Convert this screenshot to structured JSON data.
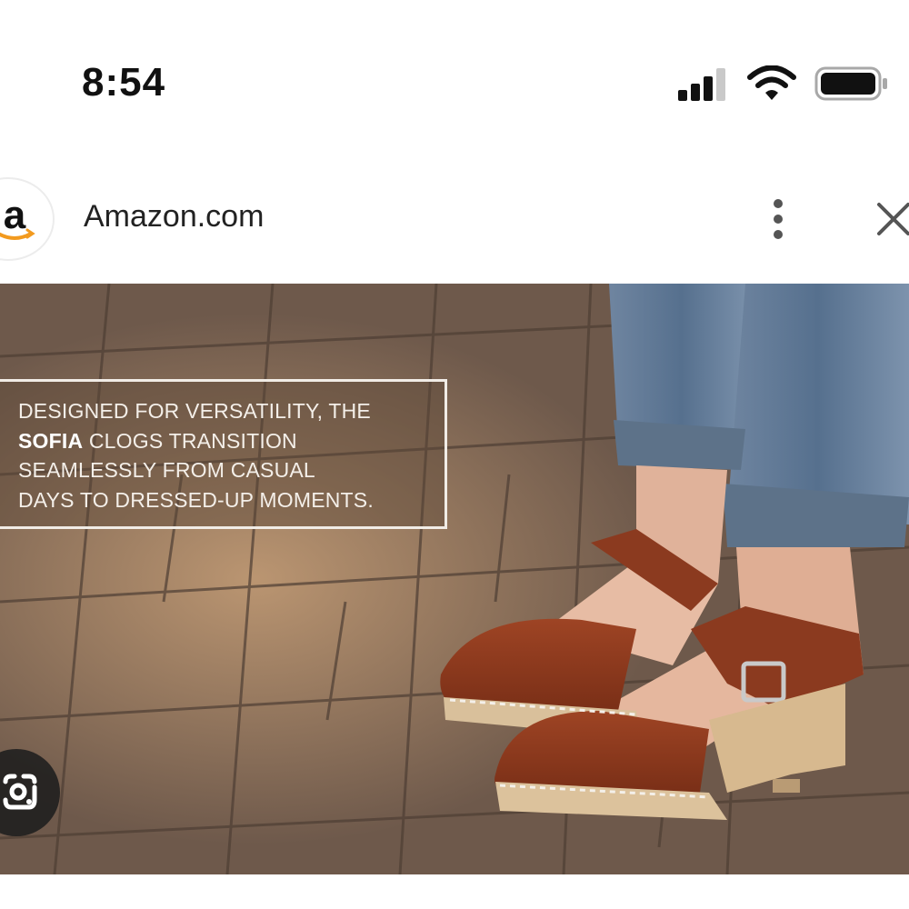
{
  "status_bar": {
    "time": "8:54",
    "signal_icon": "cellular-signal-icon",
    "wifi_icon": "wifi-icon",
    "battery_icon": "battery-icon"
  },
  "browser": {
    "favicon_icon": "amazon-logo-icon",
    "favicon_letter": "a",
    "site_name": "Amazon.com",
    "more_icon": "more-vertical-icon",
    "close_icon": "close-icon"
  },
  "hero": {
    "promo_lines": [
      "DESIGNED FOR VERSATILITY, THE",
      "SOFIA",
      " CLOGS TRANSITION",
      "SEAMLESSLY FROM CASUAL",
      "DAYS TO DRESSED-UP MOMENTS."
    ],
    "lens_icon": "google-lens-icon"
  },
  "colors": {
    "clog_leather": "#8a3a1f",
    "denim": "#5d7289",
    "pavement": "#6b5547",
    "amazon_orange": "#f29a1f"
  }
}
